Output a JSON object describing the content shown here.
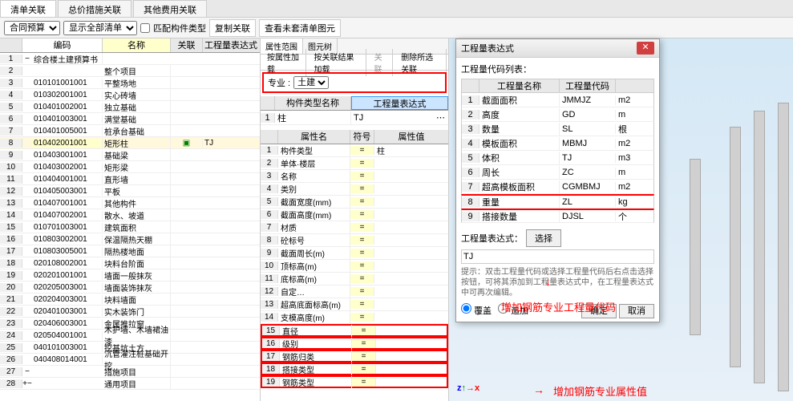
{
  "title": "清单关联",
  "main_tabs": [
    "清单关联",
    "总价措施关联",
    "其他费用关联"
  ],
  "toolbar": {
    "budget": "合同预算",
    "show": "显示全部清单",
    "match": "匹配构件类型",
    "copy": "复制关联",
    "view": "查看未套清单图元"
  },
  "left": {
    "hdr": {
      "code": "编码",
      "name": "名称",
      "rel": "关联",
      "expr": "工程量表达式"
    },
    "rows": [
      {
        "n": 1,
        "t": "−",
        "c": "综合楼土建预算书",
        "nm": ""
      },
      {
        "n": 2,
        "t": "",
        "c": "",
        "nm": "整个项目"
      },
      {
        "n": 3,
        "t": "",
        "c": "010101001001",
        "nm": "平整场地"
      },
      {
        "n": 4,
        "t": "",
        "c": "010302001001",
        "nm": "实心砖墙"
      },
      {
        "n": 5,
        "t": "",
        "c": "010401002001",
        "nm": "独立基础"
      },
      {
        "n": 6,
        "t": "",
        "c": "010401003001",
        "nm": "满堂基础"
      },
      {
        "n": 7,
        "t": "",
        "c": "010401005001",
        "nm": "桩承台基础"
      },
      {
        "n": 8,
        "t": "",
        "c": "010402001001",
        "nm": "矩形柱",
        "rel": "▣",
        "expr": "TJ",
        "sel": true
      },
      {
        "n": 9,
        "t": "",
        "c": "010403001001",
        "nm": "基础梁"
      },
      {
        "n": 10,
        "t": "",
        "c": "010403002001",
        "nm": "矩形梁"
      },
      {
        "n": 11,
        "t": "",
        "c": "010404001001",
        "nm": "直形墙"
      },
      {
        "n": 12,
        "t": "",
        "c": "010405003001",
        "nm": "平板"
      },
      {
        "n": 13,
        "t": "",
        "c": "010407001001",
        "nm": "其他构件"
      },
      {
        "n": 14,
        "t": "",
        "c": "010407002001",
        "nm": "散水、坡道"
      },
      {
        "n": 15,
        "t": "",
        "c": "010701003001",
        "nm": "建筑面积"
      },
      {
        "n": 16,
        "t": "",
        "c": "010803002001",
        "nm": "保温隔热天棚"
      },
      {
        "n": 17,
        "t": "",
        "c": "010803005001",
        "nm": "隔热楼地面"
      },
      {
        "n": 18,
        "t": "",
        "c": "020108002001",
        "nm": "块料台阶面"
      },
      {
        "n": 19,
        "t": "",
        "c": "020201001001",
        "nm": "墙面一般抹灰"
      },
      {
        "n": 20,
        "t": "",
        "c": "020205003001",
        "nm": "墙面装饰抹灰"
      },
      {
        "n": 21,
        "t": "",
        "c": "020204003001",
        "nm": "块料墙面"
      },
      {
        "n": 22,
        "t": "",
        "c": "020401003001",
        "nm": "实木装饰门"
      },
      {
        "n": 23,
        "t": "",
        "c": "020406003001",
        "nm": "金属推拉窗"
      },
      {
        "n": 24,
        "t": "",
        "c": "020504001001",
        "nm": "木护墙、木墙裙油漆"
      },
      {
        "n": 25,
        "t": "",
        "c": "040101003001",
        "nm": "挖基坑土方"
      },
      {
        "n": 26,
        "t": "",
        "c": "040408014001",
        "nm": "沉管灌注桩基础开挖"
      },
      {
        "n": 27,
        "t": "−",
        "c": "",
        "nm": "措施项目"
      },
      {
        "n": 28,
        "t": "+−",
        "c": "",
        "nm": "通用项目"
      }
    ]
  },
  "mid": {
    "tabs1": [
      "属性范围",
      "图元树"
    ],
    "tabs2": [
      "按属性加载",
      "按关联结果加载",
      "关联",
      "删除所选关联"
    ],
    "disc_label": "专业 :",
    "disc_val": "土建",
    "comp_hdr": {
      "name": "构件类型名称",
      "expr": "工程量表达式"
    },
    "comp_row": {
      "n": 1,
      "name": "柱",
      "expr": "TJ"
    },
    "prop_hdr": {
      "name": "属性名",
      "sym": "符号",
      "val": "属性值"
    },
    "props": [
      {
        "n": 1,
        "name": "构件类型",
        "val": "柱"
      },
      {
        "n": 2,
        "name": "单体·楼层"
      },
      {
        "n": 3,
        "name": "名称"
      },
      {
        "n": 4,
        "name": "类别"
      },
      {
        "n": 5,
        "name": "截面宽度(mm)"
      },
      {
        "n": 6,
        "name": "截面高度(mm)"
      },
      {
        "n": 7,
        "name": "材质"
      },
      {
        "n": 8,
        "name": "砼标号"
      },
      {
        "n": 9,
        "name": "截面周长(m)"
      },
      {
        "n": 10,
        "name": "顶标高(m)"
      },
      {
        "n": 11,
        "name": "底标高(m)"
      },
      {
        "n": 12,
        "name": "自定…"
      },
      {
        "n": 13,
        "name": "超高底面标高(m)"
      },
      {
        "n": 14,
        "name": "支模高度(m)"
      },
      {
        "n": 15,
        "name": "直径",
        "red": true
      },
      {
        "n": 16,
        "name": "级别",
        "red": true
      },
      {
        "n": 17,
        "name": "钢筋归类",
        "red": true
      },
      {
        "n": 18,
        "name": "搭接类型",
        "red": true
      },
      {
        "n": 19,
        "name": "钢筋类型",
        "red": true
      }
    ]
  },
  "dlg": {
    "title": "工程量表达式",
    "list_label": "工程量代码列表：",
    "hdr": {
      "name": "工程量名称",
      "code": "工程量代码"
    },
    "rows": [
      {
        "n": 1,
        "name": "截面面积",
        "code": "JMMJZ",
        "u": "m2"
      },
      {
        "n": 2,
        "name": "高度",
        "code": "GD",
        "u": "m"
      },
      {
        "n": 3,
        "name": "数量",
        "code": "SL",
        "u": "根"
      },
      {
        "n": 4,
        "name": "模板面积",
        "code": "MBMJ",
        "u": "m2"
      },
      {
        "n": 5,
        "name": "体积",
        "code": "TJ",
        "u": "m3"
      },
      {
        "n": 6,
        "name": "周长",
        "code": "ZC",
        "u": "m"
      },
      {
        "n": 7,
        "name": "超高模板面积",
        "code": "CGMBMJ",
        "u": "m2"
      },
      {
        "n": 8,
        "name": "重量",
        "code": "ZL",
        "u": "kg",
        "red": true
      },
      {
        "n": 9,
        "name": "搭接数量",
        "code": "DJSL",
        "u": "个",
        "red": true
      }
    ],
    "expr_label": "工程量表达式：",
    "expr_val": "TJ",
    "select": "选择",
    "hint": "提示：双击工程量代码或选择工程量代码后右点击选择按钮，可将其添加到工程量表达式中，在工程量表达式中可再次编辑。",
    "cover": "覆盖",
    "append": "追加",
    "ok": "确定",
    "cancel": "取消"
  },
  "anno1": "增加钢筋专业工程量代码",
  "anno2": "增加钢筋专业属性值"
}
